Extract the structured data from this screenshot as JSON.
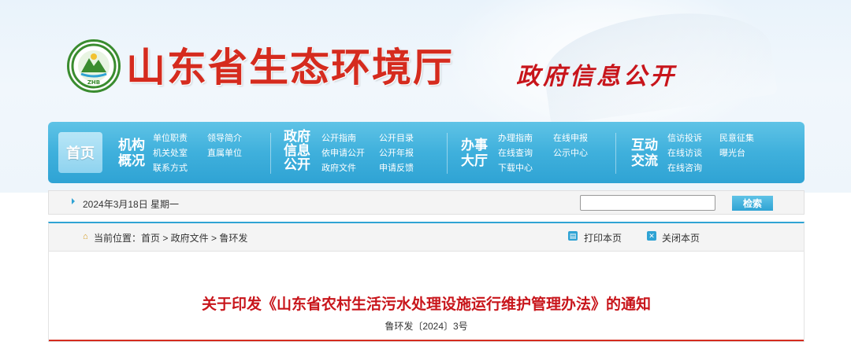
{
  "header": {
    "site_title": "山东省生态环境厅",
    "logo_text": "ZHB",
    "section_title": "政府信息公开"
  },
  "nav": {
    "home": "首页",
    "groups": [
      {
        "title_line1": "机构",
        "title_line2": "概况",
        "links": [
          "单位职责",
          "领导简介",
          "机关处室",
          "直属单位",
          "联系方式"
        ]
      },
      {
        "title_line1": "政府",
        "title_line2": "信息",
        "title_line3": "公开",
        "links": [
          "公开指南",
          "公开目录",
          "依申请公开",
          "公开年报",
          "政府文件",
          "申请反馈"
        ]
      },
      {
        "title_line1": "办事",
        "title_line2": "大厅",
        "links": [
          "办理指南",
          "在线申报",
          "在线查询",
          "公示中心",
          "下载中心"
        ]
      },
      {
        "title_line1": "互动",
        "title_line2": "交流",
        "links": [
          "信访投诉",
          "民意征集",
          "在线访谈",
          "曝光台",
          "在线咨询"
        ]
      }
    ]
  },
  "datebar": {
    "date": "2024年3月18日 星期一",
    "search_value": "",
    "search_button": "检索"
  },
  "breadcrumb": {
    "text": "当前位置：首页 > 政府文件 > 鲁环发",
    "print": "打印本页",
    "close": "关闭本页"
  },
  "document": {
    "title": "关于印发《山东省农村生活污水处理设施运行维护管理办法》的通知",
    "number": "鲁环发〔2024〕3号"
  },
  "colors": {
    "title_red": "#d52b1e",
    "nav_blue": "#2fa3d4",
    "logo_green": "#3a8c2f"
  }
}
